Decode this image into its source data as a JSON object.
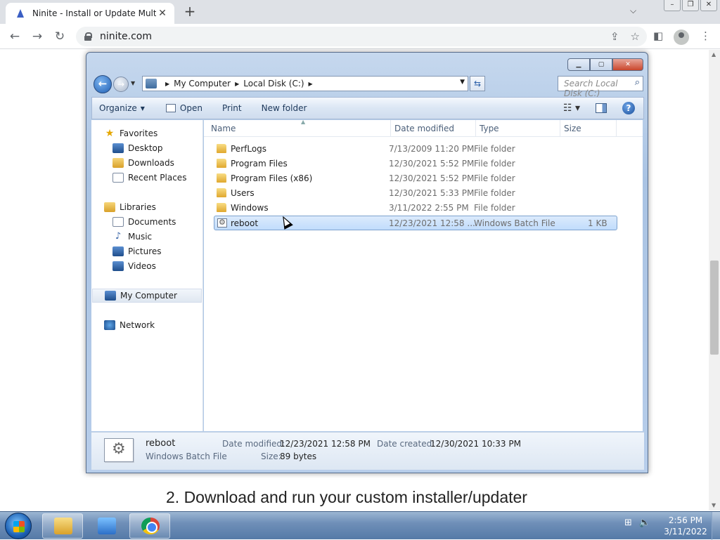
{
  "browser": {
    "tab_title": "Ninite - Install or Update Multipl",
    "url": "ninite.com",
    "page_heading": "2. Download and run your custom installer/updater"
  },
  "explorer": {
    "breadcrumb": [
      "My Computer",
      "Local Disk (C:)"
    ],
    "search_placeholder": "Search Local Disk (C:)",
    "toolbar": {
      "organize": "Organize",
      "open": "Open",
      "print": "Print",
      "new_folder": "New folder"
    },
    "nav": {
      "favorites": "Favorites",
      "desktop": "Desktop",
      "downloads": "Downloads",
      "recent_places": "Recent Places",
      "libraries": "Libraries",
      "documents": "Documents",
      "music": "Music",
      "pictures": "Pictures",
      "videos": "Videos",
      "my_computer": "My Computer",
      "network": "Network"
    },
    "columns": {
      "name": "Name",
      "date": "Date modified",
      "type": "Type",
      "size": "Size"
    },
    "files": [
      {
        "name": "PerfLogs",
        "date": "7/13/2009 11:20 PM",
        "type": "File folder",
        "size": ""
      },
      {
        "name": "Program Files",
        "date": "12/30/2021 5:52 PM",
        "type": "File folder",
        "size": ""
      },
      {
        "name": "Program Files (x86)",
        "date": "12/30/2021 5:52 PM",
        "type": "File folder",
        "size": ""
      },
      {
        "name": "Users",
        "date": "12/30/2021 5:33 PM",
        "type": "File folder",
        "size": ""
      },
      {
        "name": "Windows",
        "date": "3/11/2022 2:55 PM",
        "type": "File folder",
        "size": ""
      },
      {
        "name": "reboot",
        "date": "12/23/2021 12:58 ...",
        "type": "Windows Batch File",
        "size": "1 KB"
      }
    ],
    "details": {
      "name": "reboot",
      "type": "Windows Batch File",
      "date_modified_label": "Date modified:",
      "date_modified": "12/23/2021 12:58 PM",
      "date_created_label": "Date created:",
      "date_created": "12/30/2021 10:33 PM",
      "size_label": "Size:",
      "size": "89 bytes"
    }
  },
  "taskbar": {
    "time": "2:56 PM",
    "date": "3/11/2022"
  }
}
